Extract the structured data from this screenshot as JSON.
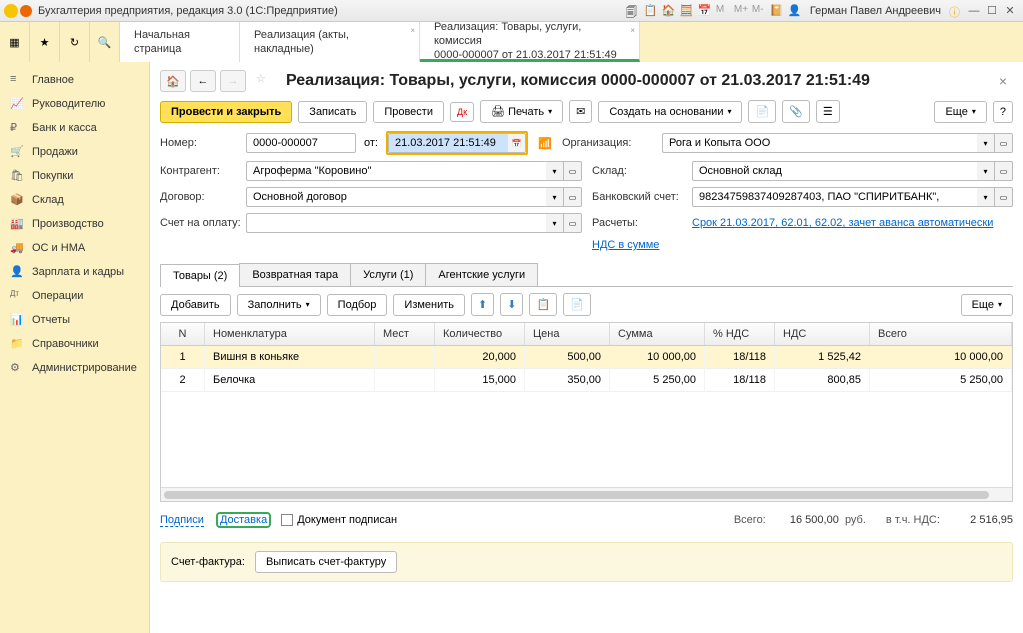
{
  "titlebar": {
    "title": "Бухгалтерия предприятия, редакция 3.0 (1С:Предприятие)",
    "username": "Герман Павел Андреевич"
  },
  "tabs_top": {
    "start": "Начальная страница",
    "t1": "Реализация (акты, накладные)",
    "t2_l1": "Реализация: Товары, услуги, комиссия",
    "t2_l2": "0000-000007 от 21.03.2017 21:51:49"
  },
  "sidebar": {
    "items": [
      {
        "label": "Главное",
        "icon": "≡"
      },
      {
        "label": "Руководителю",
        "icon": "📈"
      },
      {
        "label": "Банк и касса",
        "icon": "₽"
      },
      {
        "label": "Продажи",
        "icon": "🛒"
      },
      {
        "label": "Покупки",
        "icon": "🛍"
      },
      {
        "label": "Склад",
        "icon": "📦"
      },
      {
        "label": "Производство",
        "icon": "🏭"
      },
      {
        "label": "ОС и НМА",
        "icon": "🚚"
      },
      {
        "label": "Зарплата и кадры",
        "icon": "👤"
      },
      {
        "label": "Операции",
        "icon": "Дт"
      },
      {
        "label": "Отчеты",
        "icon": "📊"
      },
      {
        "label": "Справочники",
        "icon": "📁"
      },
      {
        "label": "Администрирование",
        "icon": "⚙"
      }
    ]
  },
  "page": {
    "heading": "Реализация: Товары, услуги, комиссия 0000-000007 от 21.03.2017 21:51:49"
  },
  "toolbar": {
    "post_close": "Провести и закрыть",
    "write": "Записать",
    "post": "Провести",
    "print": "Печать",
    "create_based": "Создать на основании",
    "more": "Еще"
  },
  "form": {
    "number_lbl": "Номер:",
    "number": "0000-000007",
    "from_lbl": "от:",
    "date": "21.03.2017 21:51:49",
    "org_lbl": "Организация:",
    "org": "Рога и Копыта ООО",
    "counterparty_lbl": "Контрагент:",
    "counterparty": "Агроферма \"Коровино\"",
    "warehouse_lbl": "Склад:",
    "warehouse": "Основной склад",
    "contract_lbl": "Договор:",
    "contract": "Основной договор",
    "bank_lbl": "Банковский счет:",
    "bank": "98234759837409287403, ПАО \"СПИРИТБАНК\",",
    "invoice_for_lbl": "Счет на оплату:",
    "calc_lbl": "Расчеты:",
    "calc_link": "Срок 21.03.2017, 62.01, 62.02, зачет аванса автоматически",
    "vat_link": "НДС в сумме"
  },
  "doctabs": {
    "goods": "Товары (2)",
    "tara": "Возвратная тара",
    "services": "Услуги (1)",
    "agency": "Агентские услуги"
  },
  "gridtoolbar": {
    "add": "Добавить",
    "fill": "Заполнить",
    "select": "Подбор",
    "edit": "Изменить",
    "more": "Еще"
  },
  "grid": {
    "head": {
      "n": "N",
      "nom": "Номенклатура",
      "places": "Мест",
      "qty": "Количество",
      "price": "Цена",
      "sum": "Сумма",
      "vatpct": "% НДС",
      "vat": "НДС",
      "total": "Всего"
    },
    "rows": [
      {
        "n": "1",
        "nom": "Вишня в коньяке",
        "places": "",
        "qty": "20,000",
        "price": "500,00",
        "sum": "10 000,00",
        "vatpct": "18/118",
        "vat": "1 525,42",
        "total": "10 000,00"
      },
      {
        "n": "2",
        "nom": "Белочка",
        "places": "",
        "qty": "15,000",
        "price": "350,00",
        "sum": "5 250,00",
        "vatpct": "18/118",
        "vat": "800,85",
        "total": "5 250,00"
      }
    ]
  },
  "footer": {
    "sign": "Подписи",
    "delivery": "Доставка",
    "doc_signed": "Документ подписан",
    "total_lbl": "Всего:",
    "total_val": "16 500,00",
    "rub": "руб.",
    "vat_lbl": "в т.ч. НДС:",
    "vat_val": "2 516,95"
  },
  "sf": {
    "label": "Счет-фактура:",
    "issue": "Выписать счет-фактуру"
  }
}
